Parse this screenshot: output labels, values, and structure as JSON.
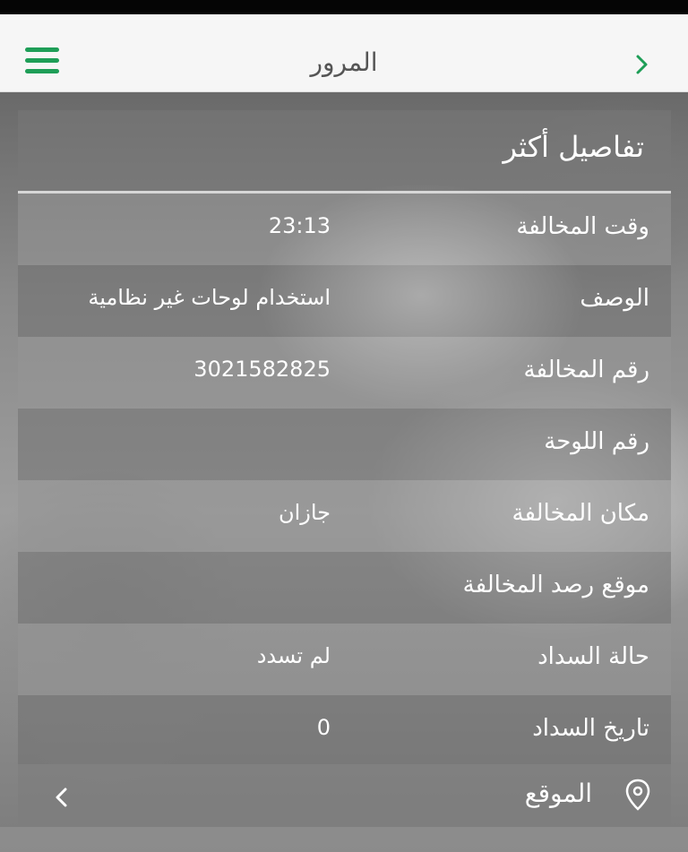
{
  "header": {
    "title": "المرور"
  },
  "details": {
    "title": "تفاصيل أكثر",
    "rows": [
      {
        "label": "وقت المخالفة",
        "value": "23:13"
      },
      {
        "label": "الوصف",
        "value": "استخدام لوحات غير نظامية"
      },
      {
        "label": "رقم المخالفة",
        "value": "3021582825"
      },
      {
        "label": "رقم اللوحة",
        "value": ""
      },
      {
        "label": "مكان المخالفة",
        "value": "جازان"
      },
      {
        "label": "موقع رصد المخالفة",
        "value": ""
      },
      {
        "label": "حالة السداد",
        "value": "لم تسدد"
      },
      {
        "label": "تاريخ السداد",
        "value": "0"
      }
    ],
    "location_label": "الموقع"
  },
  "icons": {
    "menu": "menu-icon",
    "back": "chevron-right-icon",
    "location": "map-pin-icon",
    "expand": "chevron-left-icon"
  },
  "colors": {
    "accent": "#1e9e57",
    "header_bg": "#f6f6f6"
  }
}
